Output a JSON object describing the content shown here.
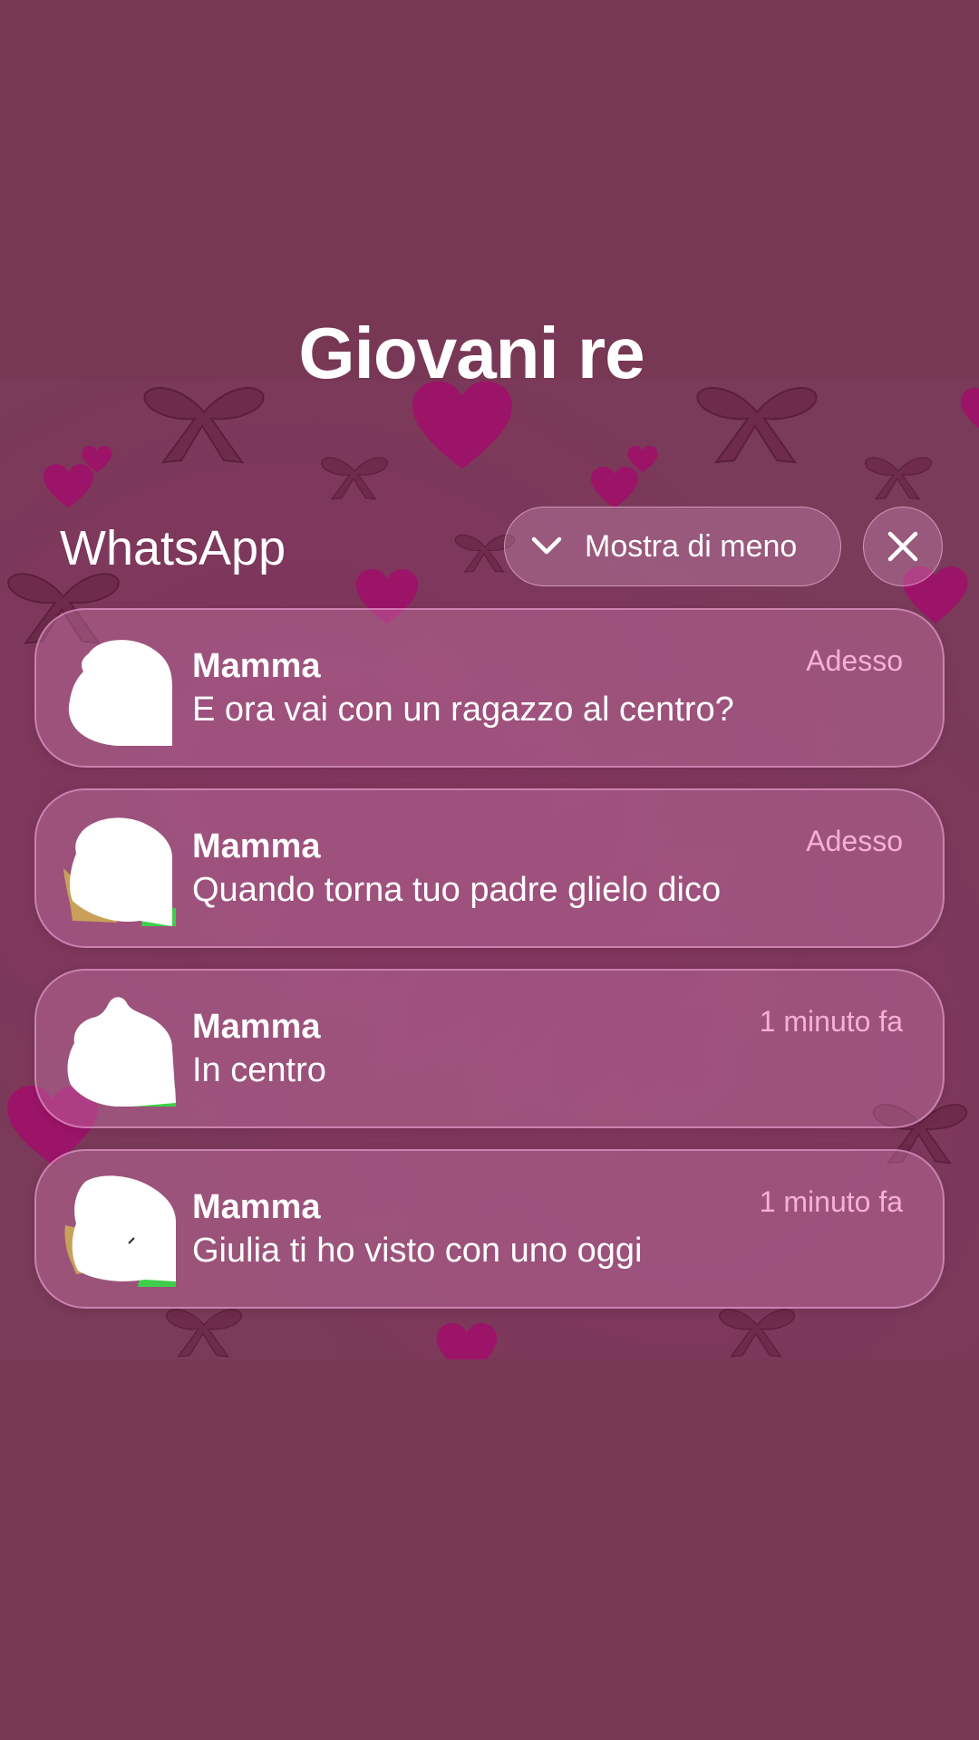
{
  "story": {
    "title": "Giovani re"
  },
  "notification_group": {
    "app_name": "WhatsApp",
    "show_less_label": "Mostra di meno",
    "notifications": [
      {
        "sender": "Mamma",
        "message": "E ora vai con un ragazzo al centro?",
        "time": "Adesso"
      },
      {
        "sender": "Mamma",
        "message": "Quando torna tuo padre glielo dico",
        "time": "Adesso"
      },
      {
        "sender": "Mamma",
        "message": "In centro",
        "time": "1 minuto fa"
      },
      {
        "sender": "Mamma",
        "message": "Giulia ti ho visto con uno oggi",
        "time": "1 minuto fa"
      }
    ]
  },
  "icons": {
    "show_less": "chevron-down-icon",
    "close": "close-icon",
    "wallpaper": [
      "heart-icon",
      "bow-icon"
    ]
  },
  "colors": {
    "background": "#783855",
    "time_text": "#f5b0d8",
    "heart": "#a0156a"
  }
}
